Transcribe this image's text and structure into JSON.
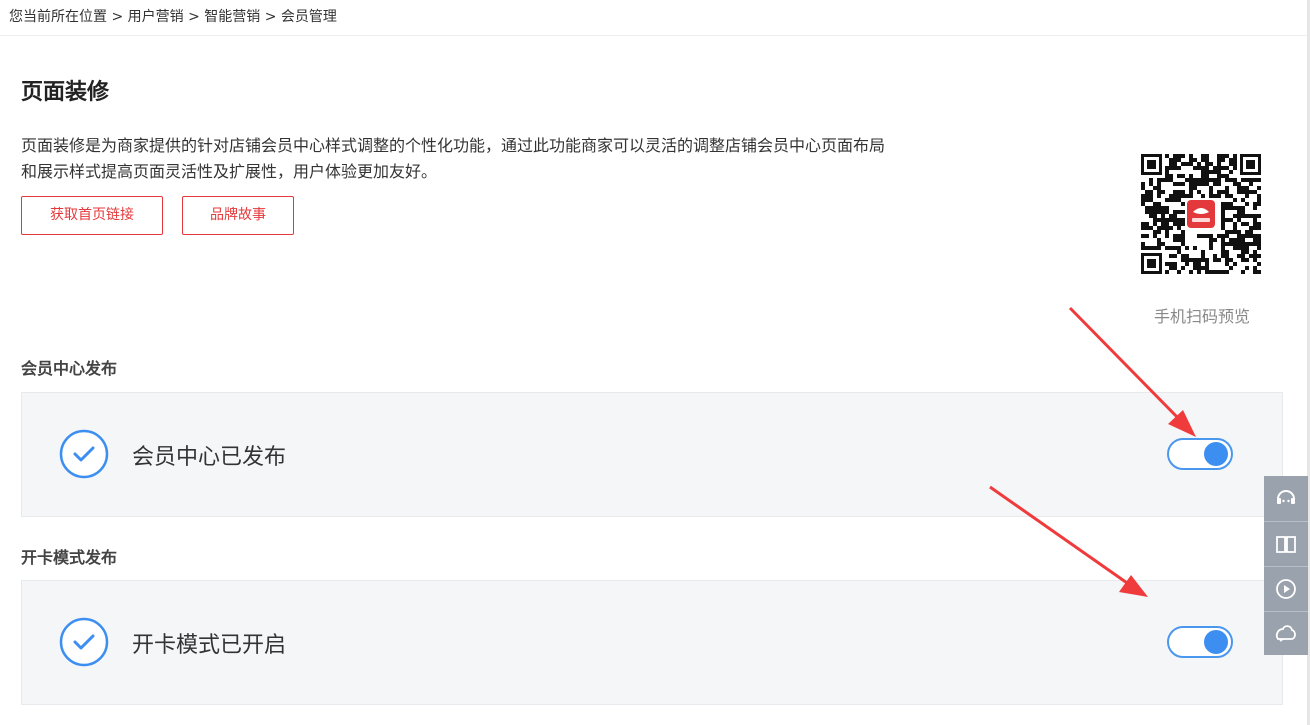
{
  "breadcrumb": {
    "prefix": "您当前所在位置 > ",
    "items": [
      "用户营销",
      "智能营销",
      "会员管理"
    ],
    "separator": " > "
  },
  "page": {
    "title": "页面装修",
    "description_line1": "页面装修是为商家提供的针对店铺会员中心样式调整的个性化功能，通过此功能商家可以灵活的调整店铺会员中心页面布局",
    "description_line2": "和展示样式提高页面灵活性及扩展性，用户体验更加友好。"
  },
  "buttons": {
    "get_home_link": "获取首页链接",
    "brand_story": "品牌故事"
  },
  "qr": {
    "caption": "手机扫码预览",
    "logo_icon": "jd-logo-icon"
  },
  "sections": [
    {
      "title": "会员中心发布",
      "status_text": "会员中心已发布",
      "toggle_on": true
    },
    {
      "title": "开卡模式发布",
      "status_text": "开卡模式已开启",
      "toggle_on": true
    }
  ],
  "float_tools": [
    "customer-service-icon",
    "book-icon",
    "play-icon",
    "feedback-icon"
  ],
  "colors": {
    "accent_red": "#e4393c",
    "accent_blue": "#3c8ff0",
    "annotation_arrow": "#ef3b3b"
  }
}
